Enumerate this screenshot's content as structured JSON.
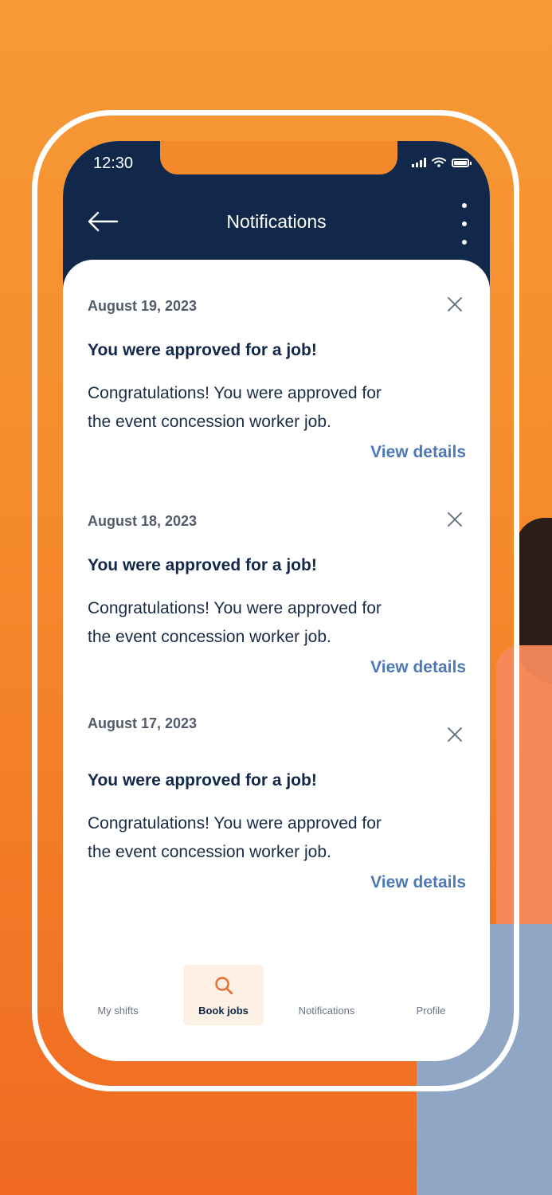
{
  "status_bar": {
    "time": "12:30"
  },
  "header": {
    "title": "Notifications"
  },
  "notifications": [
    {
      "date": "August 19, 2023",
      "headline": "You were approved for a job!",
      "body_line1": "Congratulations! You were approved for",
      "body_line2": "the event concession worker job.",
      "action_label": "View details"
    },
    {
      "date": "August 18, 2023",
      "headline": "You were approved for a job!",
      "body_line1": "Congratulations! You were approved for",
      "body_line2": "the event concession worker job.",
      "action_label": "View details"
    },
    {
      "date": "August 17, 2023",
      "headline": "You were approved for a job!",
      "body_line1": "Congratulations! You were approved for",
      "body_line2": "the event concession worker job.",
      "action_label": "View details"
    }
  ],
  "bottom_nav": {
    "items": [
      {
        "label": "My shifts",
        "active": false
      },
      {
        "label": "Book jobs",
        "active": true,
        "icon": "search-icon"
      },
      {
        "label": "Notifications",
        "active": false
      },
      {
        "label": "Profile",
        "active": false
      }
    ]
  },
  "colors": {
    "header_bg": "#12284b",
    "accent_orange": "#f58a2c",
    "link_blue": "#4d79b8"
  }
}
